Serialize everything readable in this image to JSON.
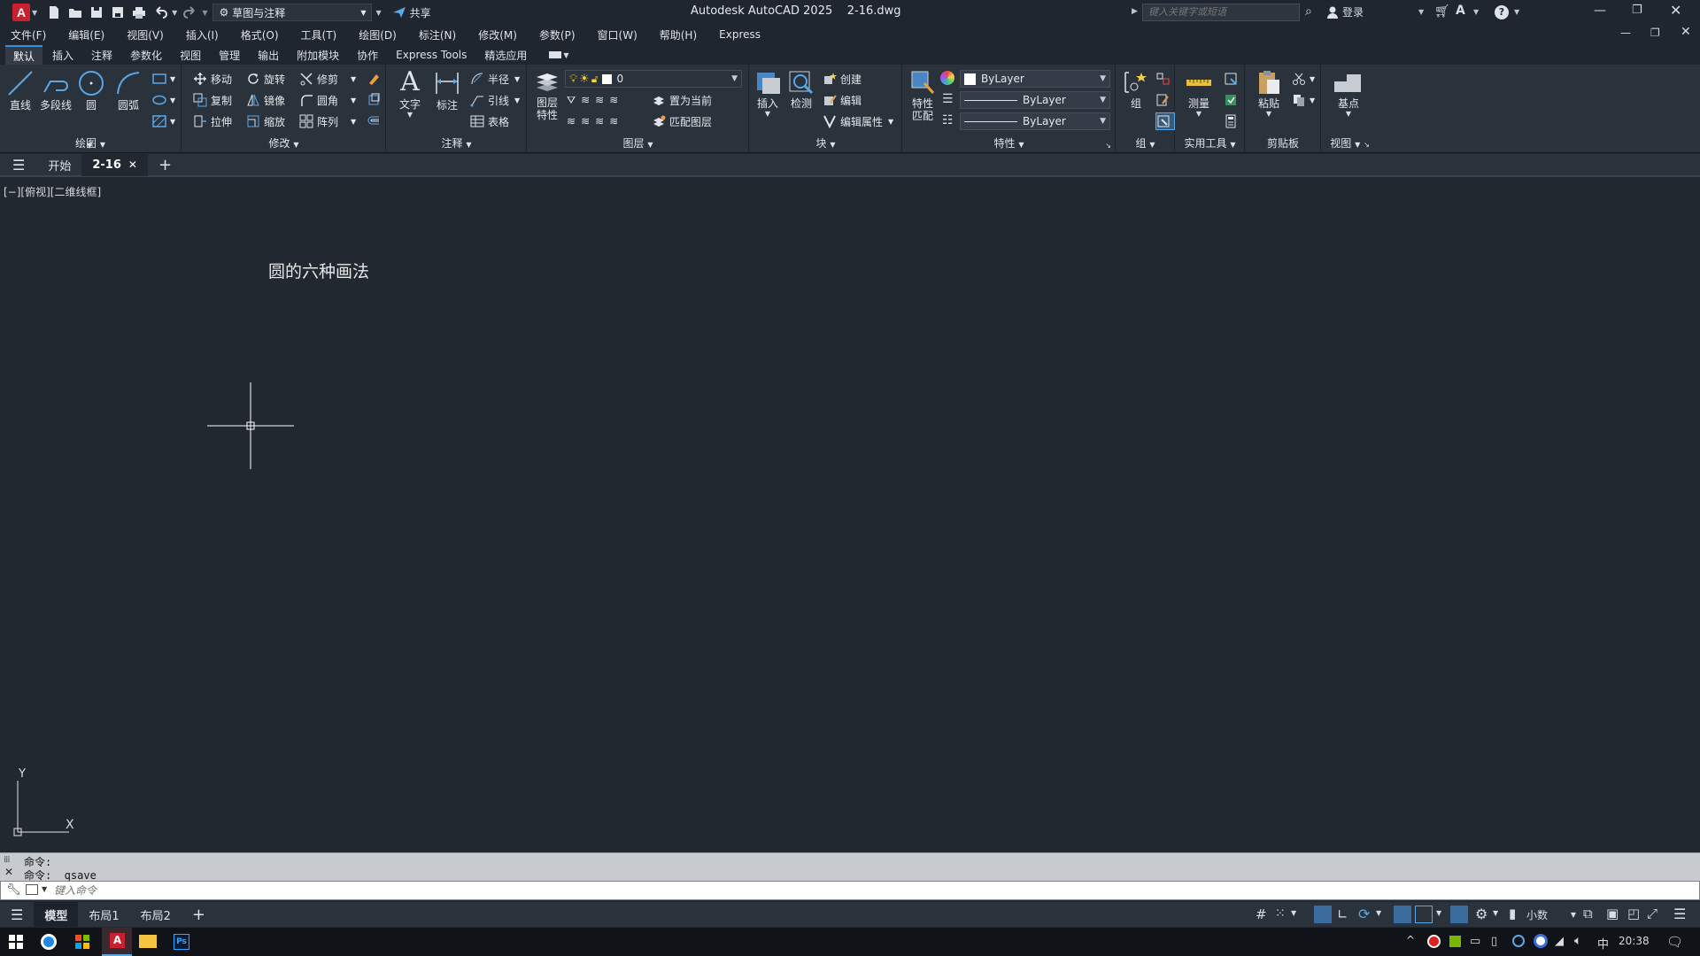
{
  "window": {
    "title": "Autodesk AutoCAD 2025",
    "filename": "2-16.dwg"
  },
  "quick_access": {
    "workspace": "草图与注释",
    "share_label": "共享"
  },
  "search": {
    "placeholder": "键入关键字或短语"
  },
  "user": {
    "login_label": "登录"
  },
  "menubar": [
    "文件(F)",
    "编辑(E)",
    "视图(V)",
    "插入(I)",
    "格式(O)",
    "工具(T)",
    "绘图(D)",
    "标注(N)",
    "修改(M)",
    "参数(P)",
    "窗口(W)",
    "帮助(H)",
    "Express"
  ],
  "ribbon_tabs": [
    "默认",
    "插入",
    "注释",
    "参数化",
    "视图",
    "管理",
    "输出",
    "附加模块",
    "协作",
    "Express Tools",
    "精选应用"
  ],
  "ribbon": {
    "draw": {
      "title": "绘图",
      "line": "直线",
      "polyline": "多段线",
      "circle": "圆",
      "arc": "圆弧"
    },
    "modify": {
      "title": "修改",
      "move": "移动",
      "rotate": "旋转",
      "trim": "修剪",
      "copy": "复制",
      "mirror": "镜像",
      "fillet": "圆角",
      "stretch": "拉伸",
      "scale": "缩放",
      "array": "阵列"
    },
    "annotation": {
      "title": "注释",
      "text": "文字",
      "dimension": "标注",
      "radius": "半径",
      "leader": "引线",
      "table": "表格"
    },
    "layers": {
      "title": "图层",
      "layer_props": "图层\n特性",
      "layer_props_1": "图层",
      "layer_props_2": "特性",
      "current_layer": "0",
      "set_current": "置为当前",
      "match_layer": "匹配图层"
    },
    "block": {
      "title": "块",
      "insert": "插入",
      "detect": "检测",
      "create": "创建",
      "edit": "编辑",
      "edit_attr": "编辑属性"
    },
    "properties": {
      "title": "特性",
      "match_1": "特性",
      "match_2": "匹配",
      "color": "ByLayer",
      "linetype": "ByLayer",
      "lineweight": "ByLayer"
    },
    "groups": {
      "title": "组",
      "group": "组"
    },
    "utilities": {
      "title": "实用工具",
      "measure": "测量"
    },
    "clipboard": {
      "title": "剪贴板",
      "paste": "粘贴"
    },
    "view": {
      "title": "视图",
      "base": "基点"
    }
  },
  "doc_tabs": {
    "start": "开始",
    "current": "2-16"
  },
  "viewport_label": "[−][俯视][二维线框]",
  "drawing_text": "圆的六种画法",
  "ucs": {
    "x": "X",
    "y": "Y"
  },
  "command": {
    "history": [
      "命令:",
      "命令: _qsave"
    ],
    "placeholder": "键入命令"
  },
  "layout_tabs": [
    "模型",
    "布局1",
    "布局2"
  ],
  "status": {
    "units": "小数"
  },
  "taskbar": {
    "time": "20:38",
    "ime": "中"
  }
}
